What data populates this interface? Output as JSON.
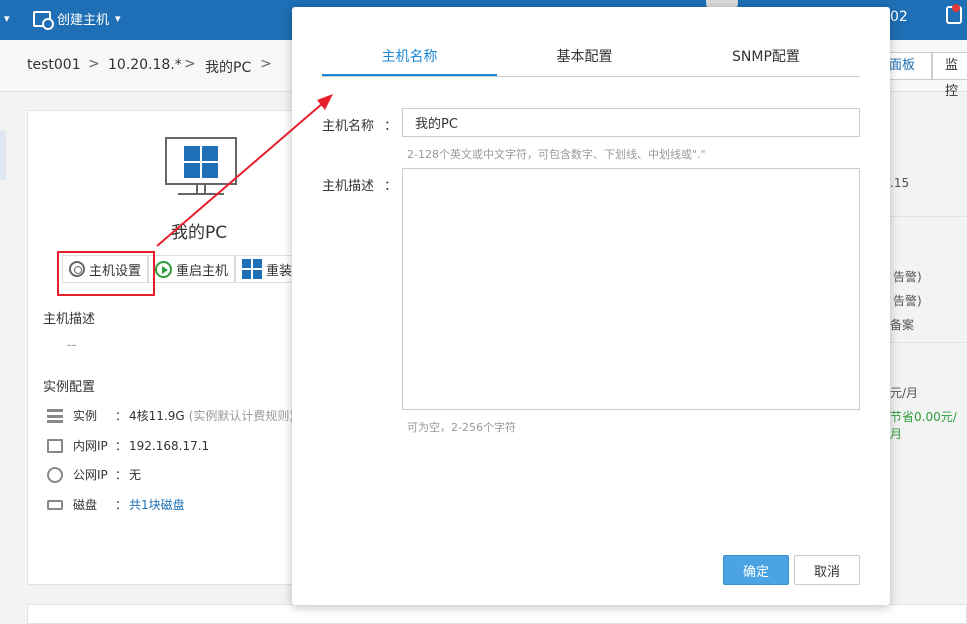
{
  "topbar": {
    "create_host": "创建主机",
    "user_suffix": "02"
  },
  "breadcrumb": {
    "items": [
      "test001",
      "10.20.18.*",
      "我的PC"
    ],
    "separator": ">"
  },
  "page_tabs": {
    "panel": "面板",
    "monitor": "监控"
  },
  "host": {
    "name": "我的PC",
    "actions": {
      "settings": "主机设置",
      "restart": "重启主机",
      "reinstall": "重装"
    },
    "desc_title": "主机描述",
    "desc_value": "--",
    "config_title": "实例配置",
    "specs": {
      "instance": {
        "label": "实例",
        "colon": "：",
        "value": "4核11.9G",
        "note": "(实例默认计费规则)"
      },
      "private_ip": {
        "label": "内网IP",
        "colon": "：",
        "value": "192.168.17.1"
      },
      "public_ip": {
        "label": "公网IP",
        "colon": "：",
        "value": "无"
      },
      "disk": {
        "label": "磁盘",
        "colon": "：",
        "value": "共1块磁盘"
      }
    }
  },
  "right_peek": {
    "ip_tail": ".15",
    "alarm1": "告警)",
    "alarm2": "告警)",
    "archive": "备案",
    "price": "元/月",
    "saving": "节省0.00元/月"
  },
  "modal": {
    "tabs": [
      "主机名称",
      "基本配置",
      "SNMP配置"
    ],
    "active_tab": 0,
    "name_label": "主机名称",
    "name_colon": "：",
    "name_value": "我的PC",
    "name_hint": "2-128个英文或中文字符，可包含数字、下划线、中划线或\".\"",
    "desc_label": "主机描述",
    "desc_colon": "：",
    "desc_value": "",
    "desc_hint": "可为空，2-256个字符",
    "ok_label": "确定",
    "cancel_label": "取消"
  },
  "colors": {
    "topbar": "#1e6fb5",
    "accent": "#1e88d6",
    "annotation": "#e5202a",
    "ok_button": "#4ba3e3"
  }
}
